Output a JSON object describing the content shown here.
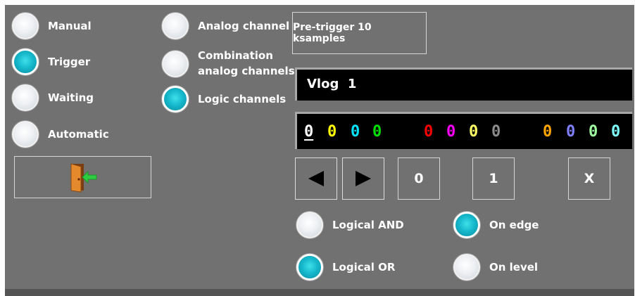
{
  "mode_options": [
    {
      "label": "Manual",
      "selected": false
    },
    {
      "label": "Trigger",
      "selected": true
    },
    {
      "label": "Waiting",
      "selected": false
    },
    {
      "label": "Automatic",
      "selected": false
    }
  ],
  "source_options": [
    {
      "label": "Analog channel",
      "selected": false
    },
    {
      "label": "Combination\nanalog channels",
      "selected": false
    },
    {
      "label": "Logic channels",
      "selected": true
    }
  ],
  "pretrigger_button": "Pre-trigger 10 ksamples",
  "vlog_display": "Vlog  1",
  "channel_digits": [
    {
      "value": "0",
      "color": "#ffffff",
      "selected": true
    },
    {
      "value": "0",
      "color": "#ffff00"
    },
    {
      "value": "0",
      "color": "#00e5ff"
    },
    {
      "value": "0",
      "color": "#00e000"
    },
    {
      "value": "0",
      "color": "#ff0000"
    },
    {
      "value": "0",
      "color": "#ff00ff"
    },
    {
      "value": "0",
      "color": "#ffff66"
    },
    {
      "value": "0",
      "color": "#8c8c8c"
    },
    {
      "value": "0",
      "color": "#ffa500"
    },
    {
      "value": "0",
      "color": "#8080ff"
    },
    {
      "value": "0",
      "color": "#a0ffa0"
    },
    {
      "value": "0",
      "color": "#80ffff"
    }
  ],
  "buttons": {
    "set_zero": "0",
    "set_one": "1",
    "clear": "X"
  },
  "logic_options": [
    {
      "label": "Logical AND",
      "selected": false
    },
    {
      "label": "Logical OR",
      "selected": true
    }
  ],
  "edge_options": [
    {
      "label": "On edge",
      "selected": true
    },
    {
      "label": "On level",
      "selected": false
    }
  ],
  "icons": {
    "exit": "exit-door-icon",
    "left": "arrow-left-icon",
    "right": "arrow-right-icon"
  }
}
